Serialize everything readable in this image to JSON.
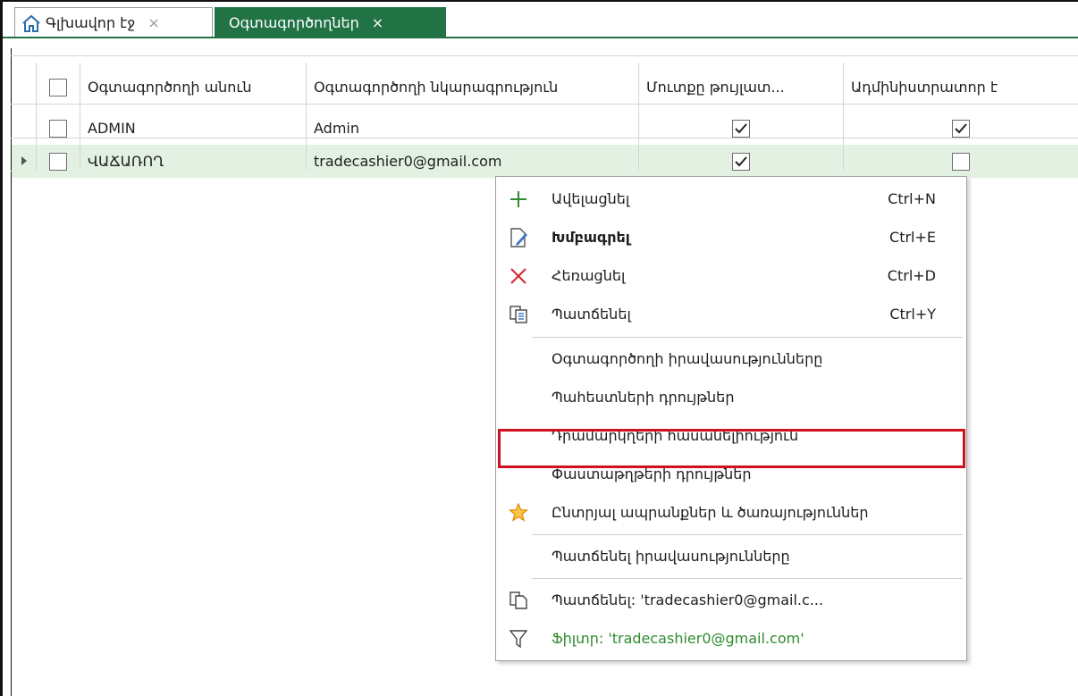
{
  "tabs": [
    {
      "label": "Գլխավոր էջ",
      "close": "×",
      "icon": "home-icon"
    },
    {
      "label": "Օգտագործողներ",
      "close": "×"
    }
  ],
  "grid": {
    "headers": [
      "Օգտագործողի անուն",
      "Օգտագործողի նկարագրություն",
      "Մուտքը թույլատ...",
      "Ադմինիստրատոր է"
    ],
    "rows": [
      {
        "name": "ADMIN",
        "description": "Admin",
        "login_allowed": true,
        "is_admin": true
      },
      {
        "name": "ՎԱՃԱՌՈՂ",
        "description": "tradecashier0@gmail.com",
        "login_allowed": true,
        "is_admin": false
      }
    ]
  },
  "context_menu": {
    "items": [
      {
        "label": "Ավելացնել",
        "shortcut": "Ctrl+N",
        "icon": "plus-icon"
      },
      {
        "label": "Խմբագրել",
        "shortcut": "Ctrl+E",
        "icon": "edit-icon"
      },
      {
        "label": "Հեռացնել",
        "shortcut": "Ctrl+D",
        "icon": "delete-x-icon"
      },
      {
        "label": "Պատճենել",
        "shortcut": "Ctrl+Y",
        "icon": "copy-document-icon"
      },
      {
        "label": "Օգտագործողի իրավասությունները"
      },
      {
        "label": "Պահեստների դրույթներ"
      },
      {
        "label": "Դրամարկղերի հասանելիություն"
      },
      {
        "label": "Փաստաթղթերի դրույթներ"
      },
      {
        "label": "Ընտրյալ ապրանքներ և ծառայություններ",
        "icon": "star-icon"
      },
      {
        "label": "Պատճենել իրավասությունները"
      },
      {
        "label": "Պատճենել: 'tradecashier0@gmail.c...",
        "icon": "copy-icon"
      },
      {
        "label": "Ֆիլտր: 'tradecashier0@gmail.com'",
        "icon": "filter-icon"
      }
    ]
  },
  "colors": {
    "accent": "#217346",
    "highlight": "#d0101c",
    "selected_row": "#e3f1e3",
    "filter_text": "#2e8b2e"
  }
}
